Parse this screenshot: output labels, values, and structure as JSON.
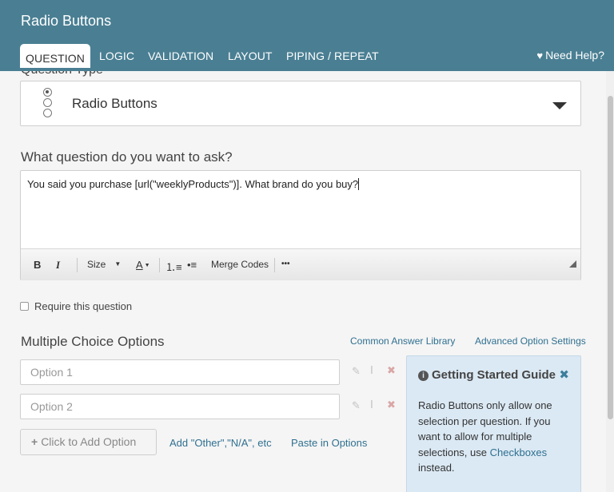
{
  "header": {
    "title": "Radio Buttons",
    "tabs": [
      "QUESTION",
      "LOGIC",
      "VALIDATION",
      "LAYOUT",
      "PIPING / REPEAT"
    ],
    "active_tab": "QUESTION",
    "help": "Need Help?"
  },
  "question_type": {
    "label": "Question Type",
    "value": "Radio Buttons"
  },
  "question": {
    "label": "What question do you want to ask?",
    "text": "You said you purchase [url(\"weeklyProducts\")]. What brand do you buy?"
  },
  "toolbar": {
    "bold": "B",
    "italic": "I",
    "size": "Size",
    "font_color": "A",
    "merge_codes": "Merge Codes",
    "more": "•••"
  },
  "require": {
    "label": "Require this question",
    "checked": false
  },
  "options": {
    "label": "Multiple Choice Options",
    "common_library": "Common Answer Library",
    "advanced_settings": "Advanced Option Settings",
    "placeholders": [
      "Option 1",
      "Option 2"
    ],
    "add_option": "Click to Add Option",
    "add_other": "Add \"Other\",\"N/A\", etc",
    "paste": "Paste in Options"
  },
  "guide": {
    "title": "Getting Started Guide",
    "body_before": "Radio Buttons only allow one selection per question. If you want to allow for multiple selections, use ",
    "body_link": "Checkboxes",
    "body_after": " instead."
  },
  "colors": {
    "header": "#4a7f93",
    "link": "#2f7090",
    "guide_bg": "#dbe9f4"
  }
}
